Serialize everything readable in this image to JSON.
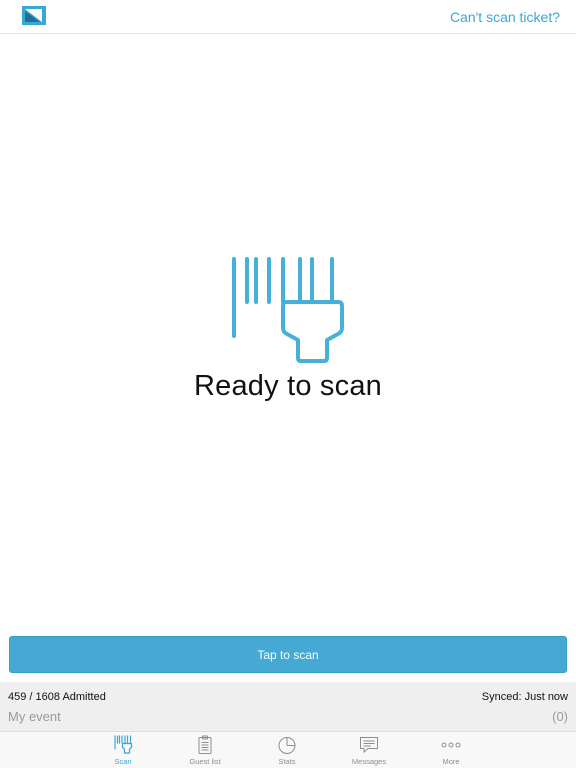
{
  "header": {
    "logo_icon": "app-logo",
    "cant_scan_link": "Can't scan ticket?"
  },
  "main": {
    "icon": "barcode-scanner-icon",
    "ready_text": "Ready to scan"
  },
  "tap_button": {
    "label": "Tap to scan"
  },
  "status": {
    "admitted": "459 / 1608 Admitted",
    "synced": "Synced: Just now",
    "event_name": "My event",
    "event_count": "(0)"
  },
  "tabbar": {
    "tabs": [
      {
        "label": "Scan",
        "icon": "scanner-icon",
        "active": true
      },
      {
        "label": "Guest list",
        "icon": "clipboard-icon",
        "active": false
      },
      {
        "label": "Stats",
        "icon": "pie-chart-icon",
        "active": false
      },
      {
        "label": "Messages",
        "icon": "message-icon",
        "active": false
      },
      {
        "label": "More",
        "icon": "more-dots-icon",
        "active": false
      }
    ]
  },
  "colors": {
    "accent": "#3aa7d4",
    "button": "#45a9d4",
    "status_bg": "#efefef",
    "muted_text": "#9a9a9a",
    "tab_inactive": "#8e8e8e"
  }
}
